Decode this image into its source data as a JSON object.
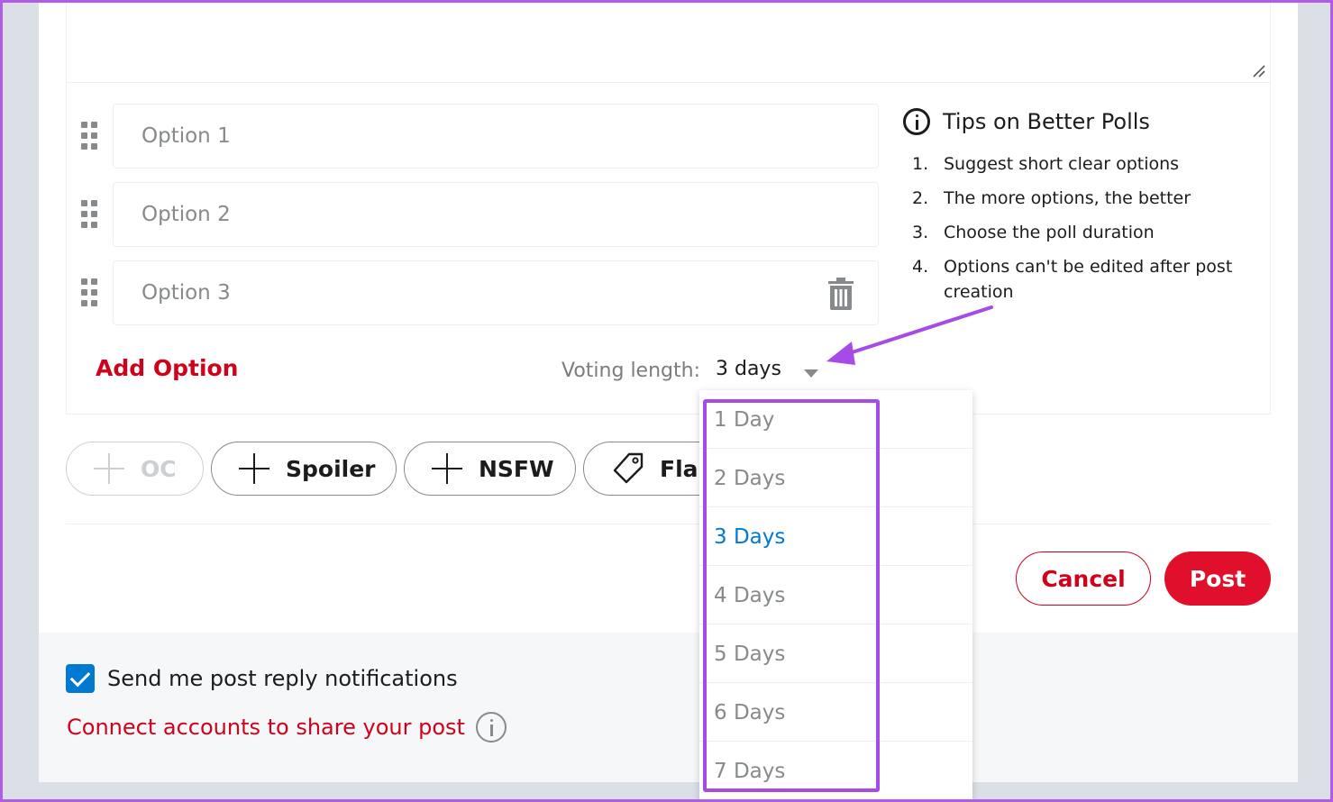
{
  "poll": {
    "options": [
      {
        "placeholder": "Option 1"
      },
      {
        "placeholder": "Option 2"
      },
      {
        "placeholder": "Option 3"
      }
    ],
    "add_option_label": "Add Option",
    "voting_length_label": "Voting length:",
    "voting_length_value": "3 days",
    "voting_length_options": [
      "1 Day",
      "2 Days",
      "3 Days",
      "4 Days",
      "5 Days",
      "6 Days",
      "7 Days"
    ],
    "selected_option": "3 Days"
  },
  "tips": {
    "title": "Tips on Better Polls",
    "items": [
      {
        "num": "1.",
        "text": "Suggest short clear options"
      },
      {
        "num": "2.",
        "text": "The more options, the better"
      },
      {
        "num": "3.",
        "text": "Choose the poll duration"
      },
      {
        "num": "4.",
        "text": "Options can't be edited after post creation"
      }
    ]
  },
  "tags": {
    "oc": "OC",
    "spoiler": "Spoiler",
    "nsfw": "NSFW",
    "flair": "Flair"
  },
  "actions": {
    "cancel": "Cancel",
    "post": "Post"
  },
  "footer": {
    "notify_label": "Send me post reply notifications",
    "connect_label": "Connect accounts to share your post"
  },
  "colors": {
    "brand_red": "#d0021b",
    "link_blue": "#0079d3",
    "highlight_purple": "#a64ae8"
  }
}
